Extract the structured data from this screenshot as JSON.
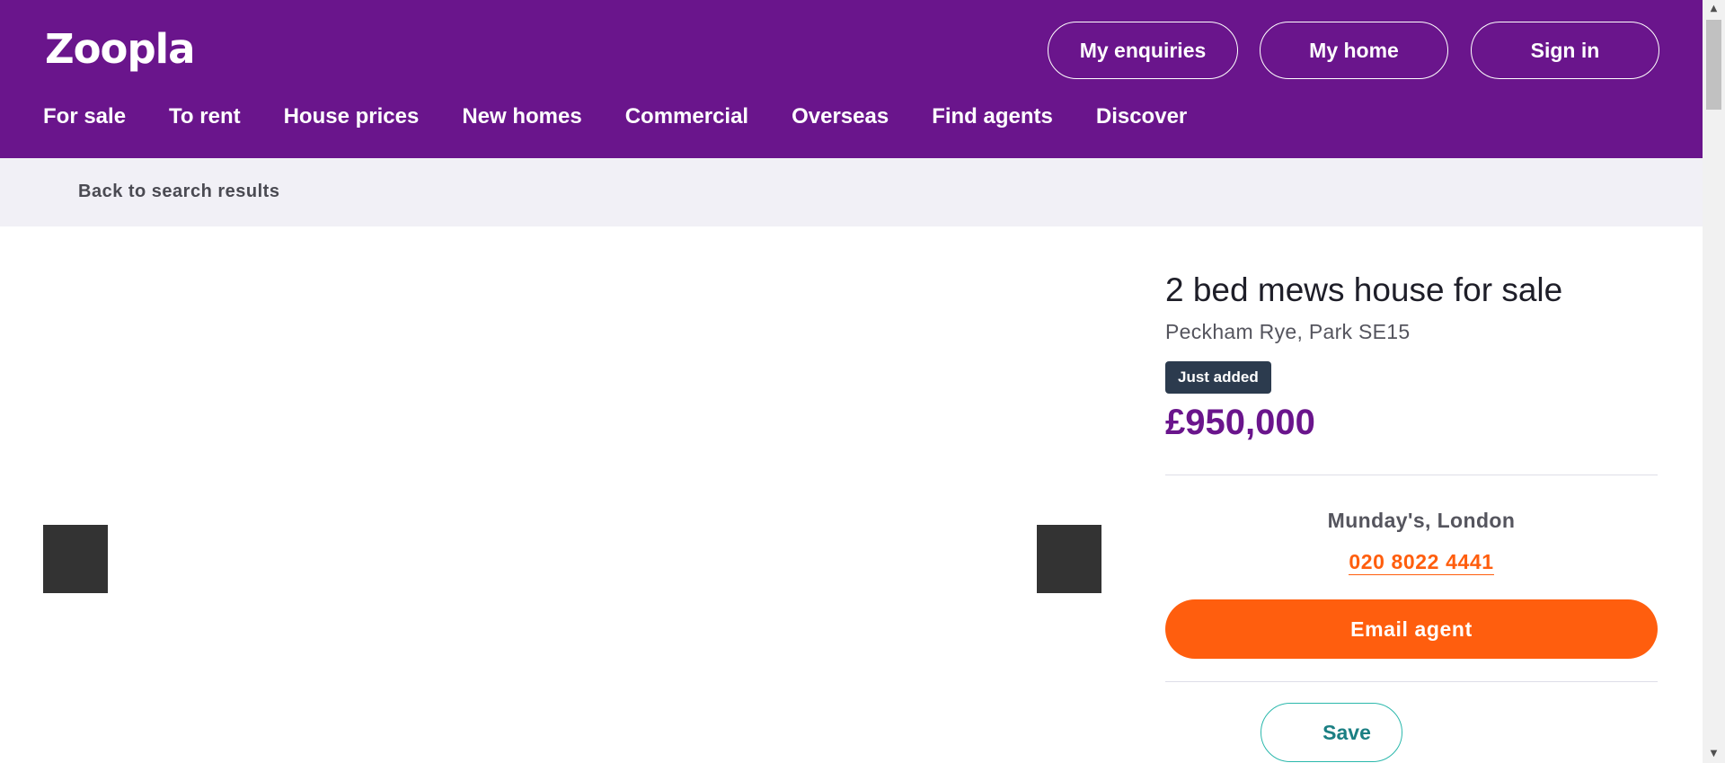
{
  "header": {
    "logo": "Zoopla",
    "buttons": {
      "enquiries": "My enquiries",
      "home": "My home",
      "signin": "Sign in"
    },
    "nav": [
      "For sale",
      "To rent",
      "House prices",
      "New homes",
      "Commercial",
      "Overseas",
      "Find agents",
      "Discover"
    ]
  },
  "breadcrumb": {
    "back": "Back to search results"
  },
  "listing": {
    "title": "2 bed mews house for sale",
    "address": "Peckham Rye, Park SE15",
    "badge": "Just added",
    "price": "£950,000"
  },
  "agent": {
    "name": "Munday's, London",
    "phone": "020 8022 4441",
    "email_label": "Email agent",
    "save_label": "Save"
  },
  "colors": {
    "brand": "#6a158c",
    "accent": "#ff5e0e",
    "badge": "#2c3b4e",
    "save_outline": "#2bb8ac"
  },
  "icons": {
    "scroll_up": "▲",
    "scroll_down": "▼"
  }
}
